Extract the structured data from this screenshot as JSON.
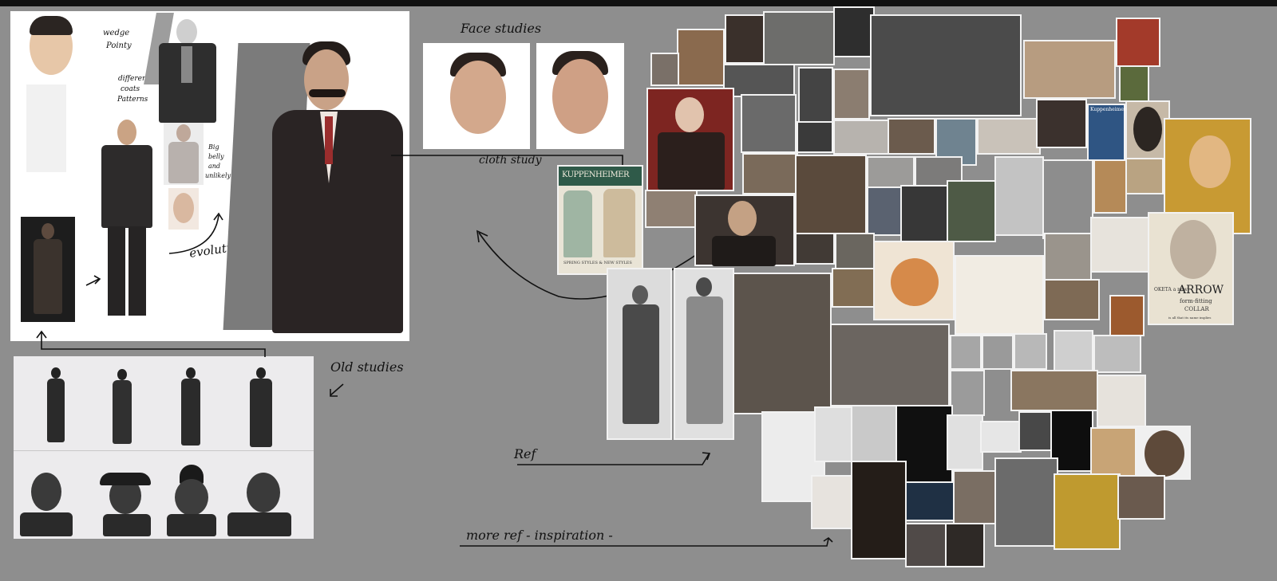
{
  "labels": {
    "wedge": "wedge",
    "pointy": "Pointy",
    "different": "different",
    "coat": "coats",
    "patterns": "Patterns",
    "big_belly": "Big",
    "belly2": "belly",
    "belly3": "and",
    "belly4": "unlikely",
    "evolution": "evolution",
    "face_studies": "Face studies",
    "cloth_study": "cloth study",
    "old_studies": "Old studies",
    "ref": "Ref",
    "more_ref": "more ref - inspiration -",
    "poster_heading": "KUPPENHEIMER",
    "poster_caption": "SPRING STYLES & NEW STYLES",
    "arrow_ad_line1": "OKETA a new",
    "arrow_ad_brand": "ARROW",
    "arrow_ad_line2": "form-fitting",
    "arrow_ad_line3": "COLLAR",
    "arrow_ad_line4": "is all that its name implies",
    "kupp_small": "Kuppenheimer"
  },
  "colors": {
    "background": "#8e8e8e",
    "topbar": "#111111",
    "panel": "#ffffff",
    "suit_dark": "#2a2424",
    "sepia": "#b59c7e"
  }
}
